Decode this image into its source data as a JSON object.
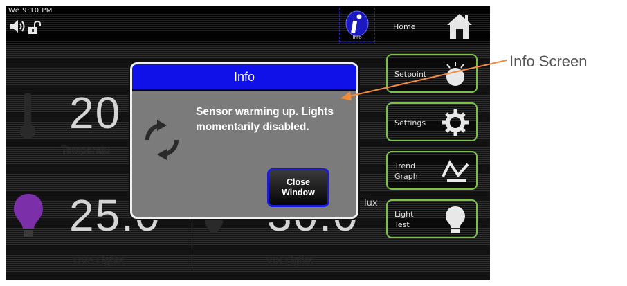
{
  "status_bar": {
    "clock": "We 9:10 PM",
    "speaker_icon": "speaker-icon",
    "lock_icon": "unlock-icon"
  },
  "nav": {
    "info_label": "Info",
    "home_label": "Home"
  },
  "readings": {
    "temperature": {
      "value": "20",
      "label": "Temperatu"
    },
    "uva": {
      "value": "25.0",
      "label": "UVA Lights"
    },
    "vis": {
      "value": "30.0",
      "unit": "lux",
      "label": "VIS Lights"
    }
  },
  "side_buttons": [
    {
      "label": "Setpoint",
      "icon": "thermometer-dial-icon"
    },
    {
      "label": "Settings",
      "icon": "gear-icon"
    },
    {
      "label": "Trend\nGraph",
      "icon": "trend-graph-icon"
    },
    {
      "label": "Light\nTest",
      "icon": "bulb-icon"
    }
  ],
  "dialog": {
    "title": "Info",
    "message": "Sensor warming up. Lights momentarily disabled.",
    "close_label": "Close\nWindow"
  },
  "annotation": {
    "label": "Info Screen",
    "color": "#f28c3c"
  },
  "colors": {
    "dialog_title_bar": "#1010e8",
    "button_border": "#7bc142",
    "uva_bulb": "#7b2fa8"
  }
}
